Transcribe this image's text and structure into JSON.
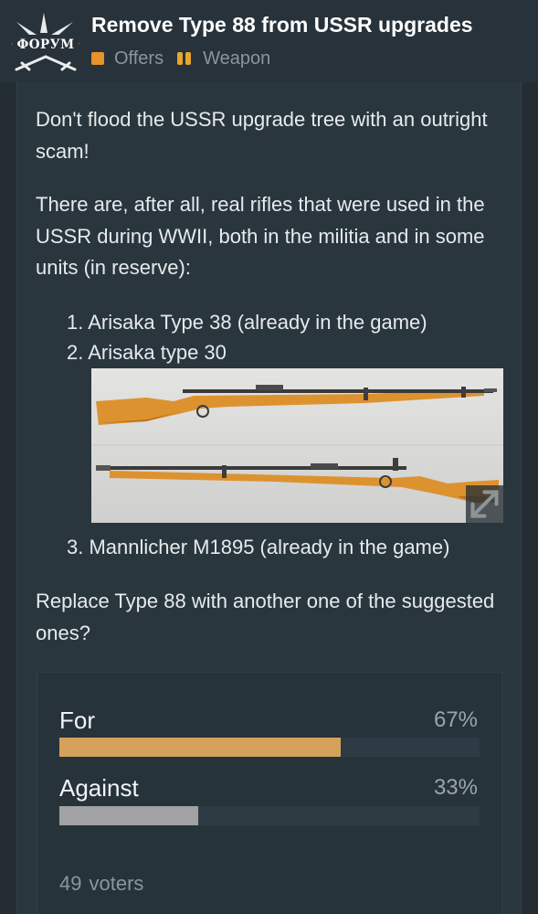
{
  "header": {
    "logo_text": "ФОРУМ",
    "title": "Remove Type 88 from USSR upgrades",
    "tags": [
      {
        "label": "Offers",
        "icon": "orange-square-icon",
        "color": "#e8922a"
      },
      {
        "label": "Weapon",
        "icon": "pause-bars-icon",
        "color": "#e8a62a"
      }
    ]
  },
  "post": {
    "paragraph_1": "Don't flood the USSR upgrade tree with an outright scam!",
    "paragraph_2": "There are, after all, real rifles that were used in the USSR during WWII, both in the militia and in some units (in reserve):",
    "list": [
      "1. Arisaka Type 38 (already in the game)",
      "2. Arisaka type 30",
      "3. Mannlicher M1895 (already in the game)"
    ],
    "image": {
      "subject": "two Arisaka type 30 rifles",
      "expand_icon": "expand-arrows-icon"
    },
    "paragraph_3": "Replace Type 88 with another one of the suggested ones?"
  },
  "poll": {
    "options": [
      {
        "label": "For",
        "percent_text": "67%",
        "fraction": 0.67,
        "color": "#d4a25b"
      },
      {
        "label": "Against",
        "percent_text": "33%",
        "fraction": 0.33,
        "color": "#a1a2a3"
      }
    ],
    "voter_count": "49",
    "voters_label": "voters"
  }
}
